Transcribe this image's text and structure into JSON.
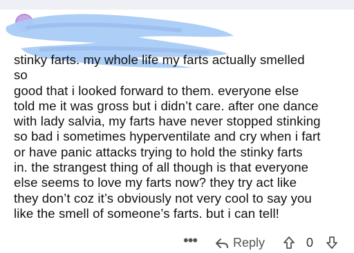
{
  "comment": {
    "text": "stinky farts. my whole life my farts actually smelled\nso\ngood that i looked forward to them. everyone else\ntold me it was gross but i didn’t care. after one dance\nwith lady salvia, my farts have never stopped stinking\nso bad i sometimes hyperventilate and cry when i fart\nor have panic attacks trying to hold the stinky farts\nin. the strangest thing of all though is that everyone\nelse seems to love my farts now? they try act like\nthey don’t coz it’s obviously not very cool to say you\nlike the smell of someone’s farts. but i can tell!"
  },
  "actions": {
    "more": "•••",
    "reply_label": "Reply",
    "vote_count": "0"
  },
  "colors": {
    "redaction": "#a9cbf7",
    "avatar": "#c7a8e6",
    "icon": "#555555"
  },
  "icons": {
    "more": "more-options-icon",
    "reply": "reply-icon",
    "upvote": "upvote-icon",
    "downvote": "downvote-icon"
  }
}
